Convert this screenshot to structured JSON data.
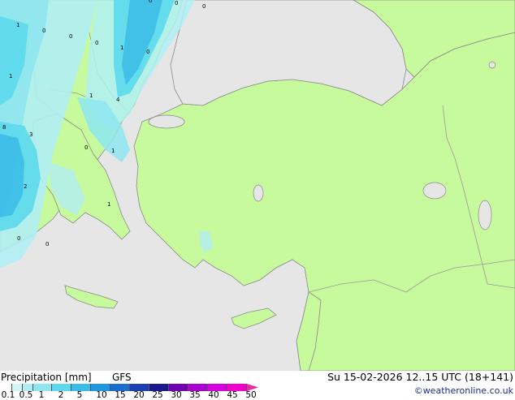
{
  "map": {
    "colors": {
      "sea": "#e6e6e6",
      "land": "#c6fa9c",
      "border": "#999999",
      "coast": "#8a8a8a"
    },
    "precip_labels": [
      "1",
      "0",
      "0",
      "0",
      "0",
      "1",
      "0",
      "1",
      "1",
      "4",
      "3",
      "8",
      "2",
      "0",
      "1",
      "1",
      "0",
      "0",
      "0",
      "0"
    ]
  },
  "legend": {
    "title": "Precipitation [mm]",
    "model": "GFS",
    "ticks": [
      "0.1",
      "0.5",
      "1",
      "2",
      "5",
      "10",
      "15",
      "20",
      "25",
      "30",
      "35",
      "40",
      "45",
      "50"
    ],
    "colors": [
      "#ffffff",
      "#d2f5f8",
      "#b0eef4",
      "#8ee6f0",
      "#5cd9ec",
      "#3bbbe8",
      "#1e96de",
      "#1a6ed0",
      "#1a3fb4",
      "#1a1a8c",
      "#7000b0",
      "#a800d0",
      "#d400e0",
      "#f000c8",
      "#e030a0"
    ]
  },
  "valid_time": "Su 15-02-2026 12..15 UTC (18+141)",
  "credit": "©weatheronline.co.uk"
}
